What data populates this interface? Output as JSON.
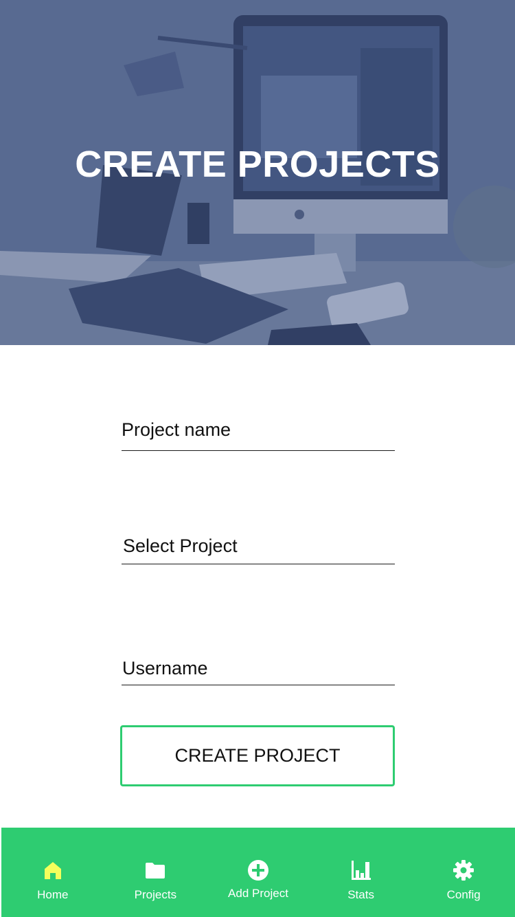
{
  "hero": {
    "title": "CREATE PROJECTS"
  },
  "form": {
    "project_name_label": "Project name",
    "select_project_label": "Select Project",
    "username_label": "Username",
    "submit_label": "CREATE PROJECT"
  },
  "nav": {
    "items": [
      {
        "label": "Home",
        "icon": "home-icon",
        "active": true
      },
      {
        "label": "Projects",
        "icon": "folder-icon"
      },
      {
        "label": "Add Project",
        "icon": "plus-circle-icon"
      },
      {
        "label": "Stats",
        "icon": "bar-chart-icon"
      },
      {
        "label": "Config",
        "icon": "gear-icon"
      }
    ]
  },
  "colors": {
    "accent": "#2ecc71",
    "active_icon": "#f4ff5c",
    "hero_tint": "#3a4e80"
  }
}
